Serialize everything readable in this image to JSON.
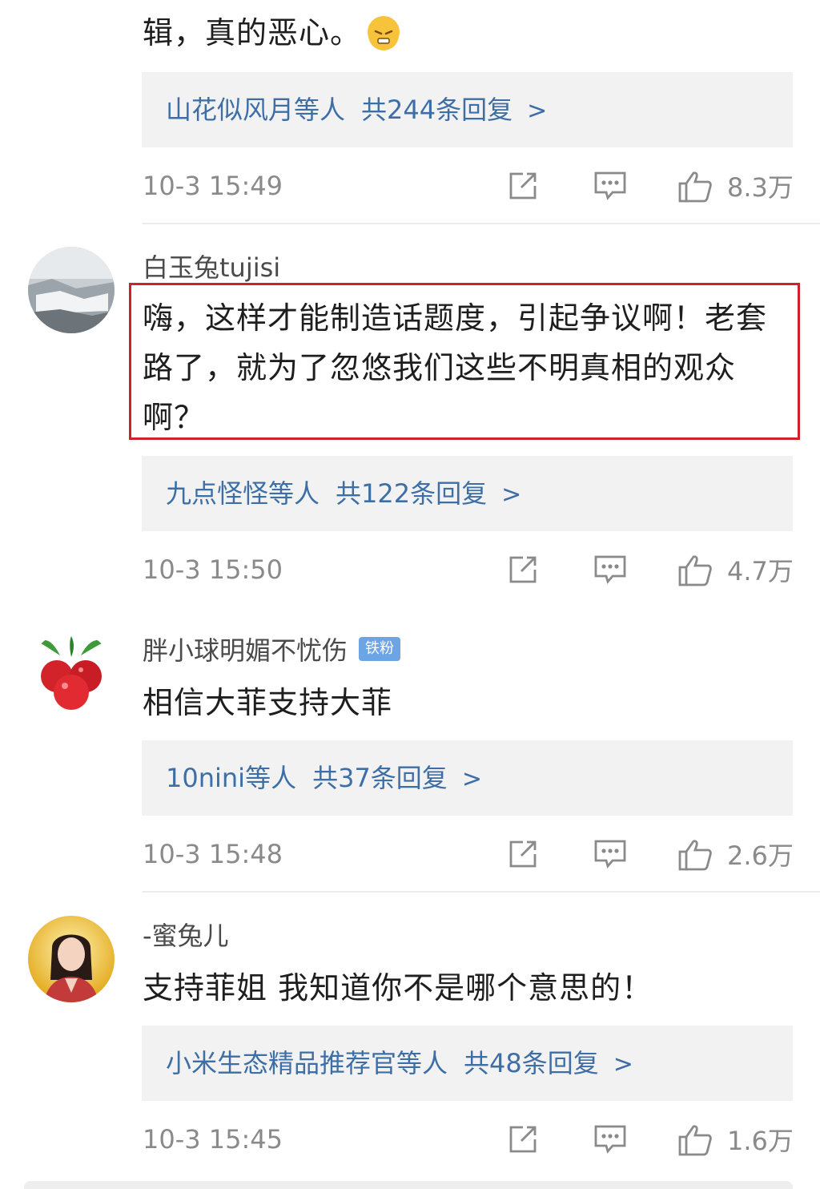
{
  "colors": {
    "link": "#3d6fa6",
    "meta": "#8a8a8a",
    "highlight_border": "#d0212b",
    "badge": "#6da4e4"
  },
  "comments": [
    {
      "text": "辑，真的恶心。",
      "emoji": "grumpy-face-emoji",
      "replies": {
        "users": "山花似风月等人",
        "count": "共244条回复"
      },
      "time": "10-3 15:49",
      "likes": "8.3万"
    },
    {
      "username": "白玉兔tujisi",
      "text": "嗨，这样才能制造话题度，引起争议啊！老套路了，就为了忽悠我们这些不明真相的观众啊？",
      "replies": {
        "users": "九点怪怪等人",
        "count": "共122条回复"
      },
      "time": "10-3 15:50",
      "likes": "4.7万"
    },
    {
      "username": "胖小球明媚不忧伤",
      "badge": "铁粉",
      "text": "相信大菲支持大菲",
      "replies": {
        "users": "10nini等人",
        "count": "共37条回复"
      },
      "time": "10-3 15:48",
      "likes": "2.6万"
    },
    {
      "username": "-蜜兔儿",
      "text": "支持菲姐 我知道你不是哪个意思的！",
      "replies": {
        "users": "小米生态精品推荐官等人",
        "count": "共48条回复"
      },
      "time": "10-3 15:45",
      "likes": "1.6万"
    }
  ]
}
